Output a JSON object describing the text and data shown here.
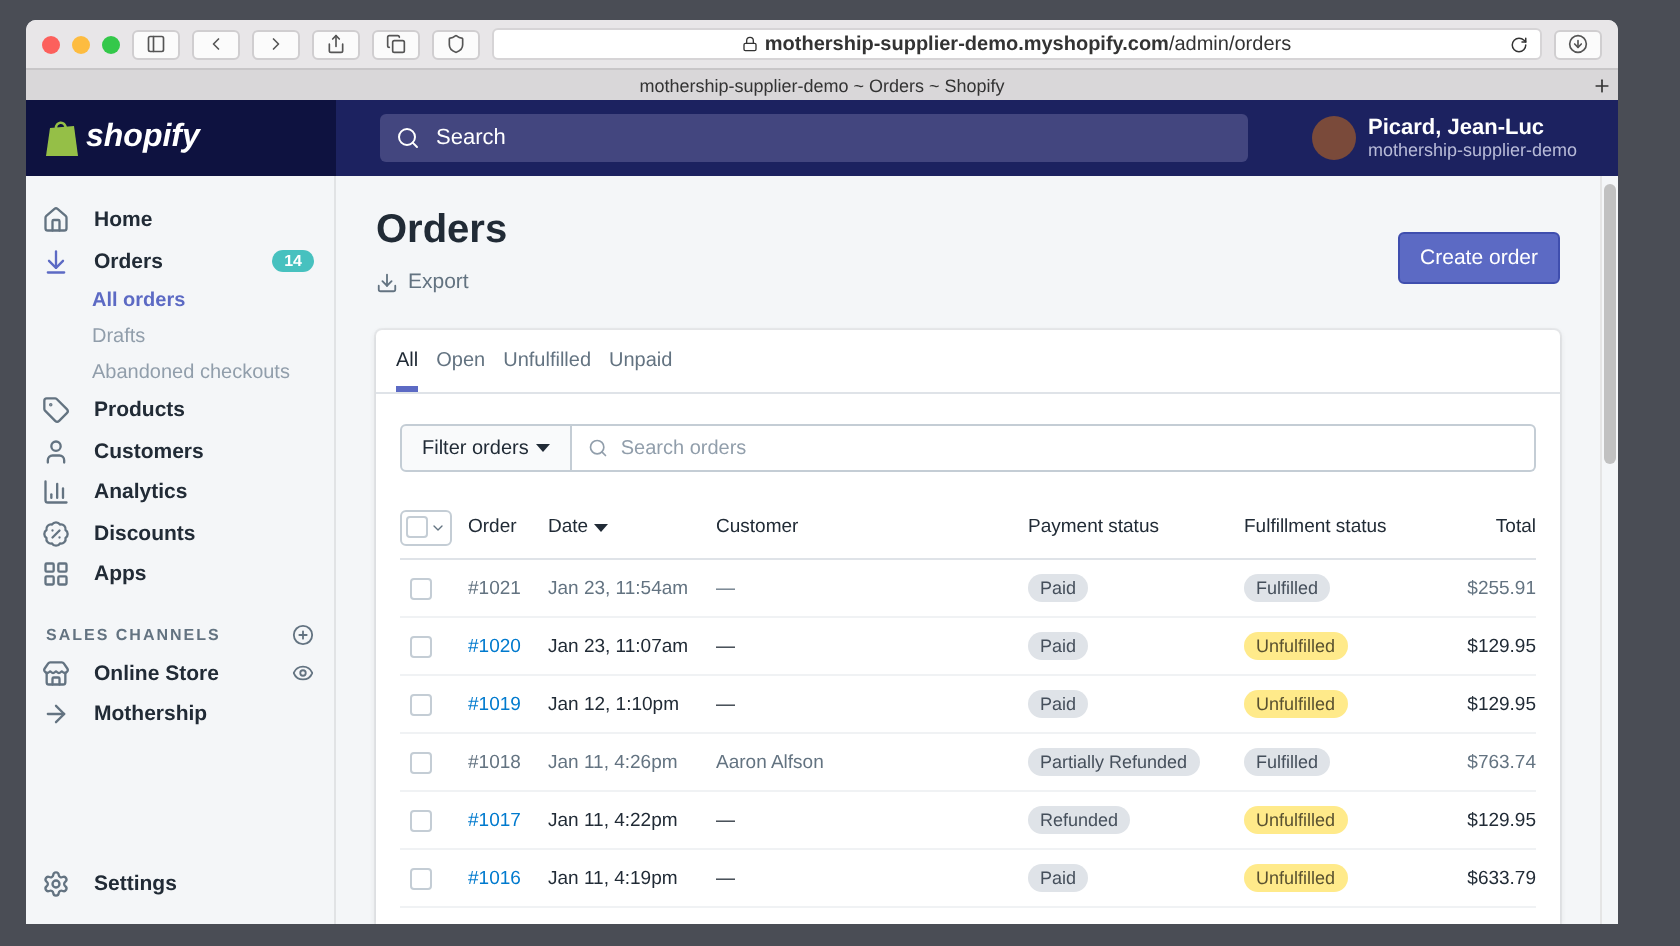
{
  "browser": {
    "url_host": "mothership-supplier-demo.myshopify.com",
    "url_path": "/admin/orders",
    "tab_title": "mothership-supplier-demo ~ Orders ~ Shopify"
  },
  "header": {
    "logo": "shopify",
    "search_placeholder": "Search",
    "user_name": "Picard, Jean-Luc",
    "store": "mothership-supplier-demo"
  },
  "sidebar": {
    "items": [
      {
        "label": "Home",
        "selected": false
      },
      {
        "label": "Orders",
        "selected": true,
        "badge": "14",
        "children": [
          {
            "label": "All orders",
            "selected": true
          },
          {
            "label": "Drafts",
            "selected": false
          },
          {
            "label": "Abandoned checkouts",
            "selected": false
          }
        ]
      },
      {
        "label": "Products",
        "selected": false
      },
      {
        "label": "Customers",
        "selected": false
      },
      {
        "label": "Analytics",
        "selected": false
      },
      {
        "label": "Discounts",
        "selected": false
      },
      {
        "label": "Apps",
        "selected": false
      }
    ],
    "section_label": "SALES CHANNELS",
    "channels": [
      {
        "label": "Online Store"
      },
      {
        "label": "Mothership"
      }
    ],
    "settings": "Settings"
  },
  "page": {
    "title": "Orders",
    "export": "Export",
    "create_button": "Create order"
  },
  "tabs": [
    {
      "label": "All",
      "selected": true
    },
    {
      "label": "Open",
      "selected": false
    },
    {
      "label": "Unfulfilled",
      "selected": false
    },
    {
      "label": "Unpaid",
      "selected": false
    }
  ],
  "filter": {
    "button": "Filter orders",
    "placeholder": "Search orders"
  },
  "table": {
    "select_all_checked": false,
    "columns": [
      "Order",
      "Date",
      "Customer",
      "Payment status",
      "Fulfillment status",
      "Total"
    ],
    "rows": [
      {
        "order": "#1021",
        "date": "Jan 23, 11:54am",
        "customer": "—",
        "payment": "Paid",
        "fulfillment": "Fulfilled",
        "fulfilled": true,
        "total": "$255.91",
        "checked": false
      },
      {
        "order": "#1020",
        "date": "Jan 23, 11:07am",
        "customer": "—",
        "payment": "Paid",
        "fulfillment": "Unfulfilled",
        "fulfilled": false,
        "total": "$129.95",
        "checked": false
      },
      {
        "order": "#1019",
        "date": "Jan 12, 1:10pm",
        "customer": "—",
        "payment": "Paid",
        "fulfillment": "Unfulfilled",
        "fulfilled": false,
        "total": "$129.95",
        "checked": false
      },
      {
        "order": "#1018",
        "date": "Jan 11, 4:26pm",
        "customer": "Aaron Alfson",
        "payment": "Partially Refunded",
        "fulfillment": "Fulfilled",
        "fulfilled": true,
        "total": "$763.74",
        "checked": false
      },
      {
        "order": "#1017",
        "date": "Jan 11, 4:22pm",
        "customer": "—",
        "payment": "Refunded",
        "fulfillment": "Unfulfilled",
        "fulfilled": false,
        "total": "$129.95",
        "checked": false
      },
      {
        "order": "#1016",
        "date": "Jan 11, 4:19pm",
        "customer": "—",
        "payment": "Paid",
        "fulfillment": "Unfulfilled",
        "fulfilled": false,
        "total": "$633.79",
        "checked": false
      }
    ]
  }
}
